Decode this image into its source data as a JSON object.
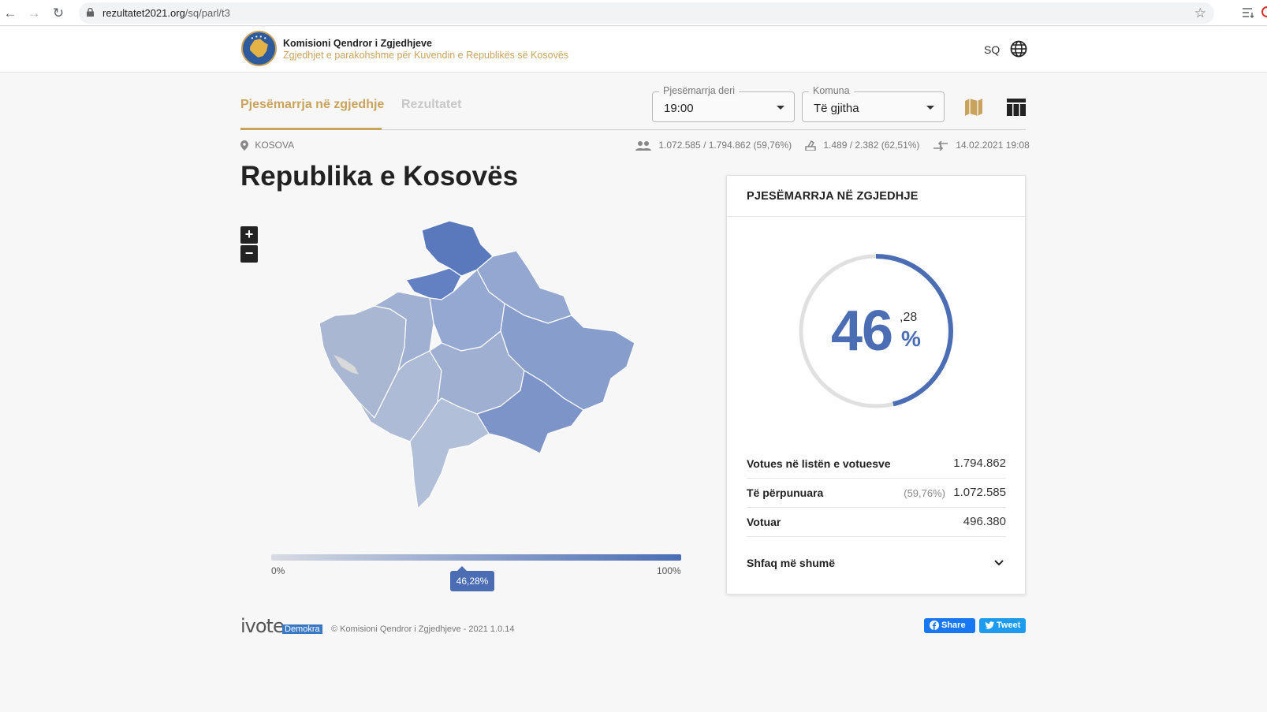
{
  "browser": {
    "url_host": "rezultatet2021.org",
    "url_path": "/sq/parl/t3"
  },
  "header": {
    "org_name": "Komisioni Qendror i Zgjedhjeve",
    "org_subtitle": "Zgjedhjet e parakohshme për Kuvendin e Republikës së Kosovës",
    "language": "SQ"
  },
  "tabs": [
    {
      "label": "Pjesëmarrja në zgjedhje",
      "active": true
    },
    {
      "label": "Rezultatet",
      "active": false
    }
  ],
  "filters": {
    "time": {
      "legend": "Pjesëmarrja deri",
      "value": "19:00"
    },
    "municipality": {
      "legend": "Komuna",
      "value": "Të gjitha"
    }
  },
  "meta": {
    "location": "KOSOVA",
    "voters": "1.072.585 / 1.794.862 (59,76%)",
    "stations": "1.489 / 2.382 (62,51%)",
    "updated": "14.02.2021 19:08"
  },
  "page_title": "Republika e Kosovës",
  "map": {
    "zoom_in": "+",
    "zoom_out": "−",
    "scale_min": "0%",
    "scale_max": "100%",
    "marker": "46,28%",
    "marker_value": 0.4628,
    "colors": {
      "light": "#d8dbe2",
      "mid": "#8fa3cc",
      "dark": "#4a6db4"
    }
  },
  "card": {
    "title": "PJESËMARRJA NË ZGJEDHJE",
    "percent_int": "46",
    "percent_dec": ",28",
    "percent_sign": "%",
    "turnout_fraction": 0.4628,
    "rows": [
      {
        "label": "Votues në listën e votuesve",
        "note": "",
        "value": "1.794.862"
      },
      {
        "label": "Të përpunuara",
        "note": "(59,76%)",
        "value": "1.072.585"
      },
      {
        "label": "Votuar",
        "note": "",
        "value": "496.380"
      }
    ],
    "show_more": "Shfaq më shumë"
  },
  "footer": {
    "brand": "ivote",
    "brand_tag": "Demokra",
    "copyright": "© Komisioni Qendror i Zgjedhjeve - 2021 1.0.14",
    "share": "Share",
    "tweet": "Tweet"
  },
  "accent": "#c9a35d",
  "primary": "#4a6db4"
}
